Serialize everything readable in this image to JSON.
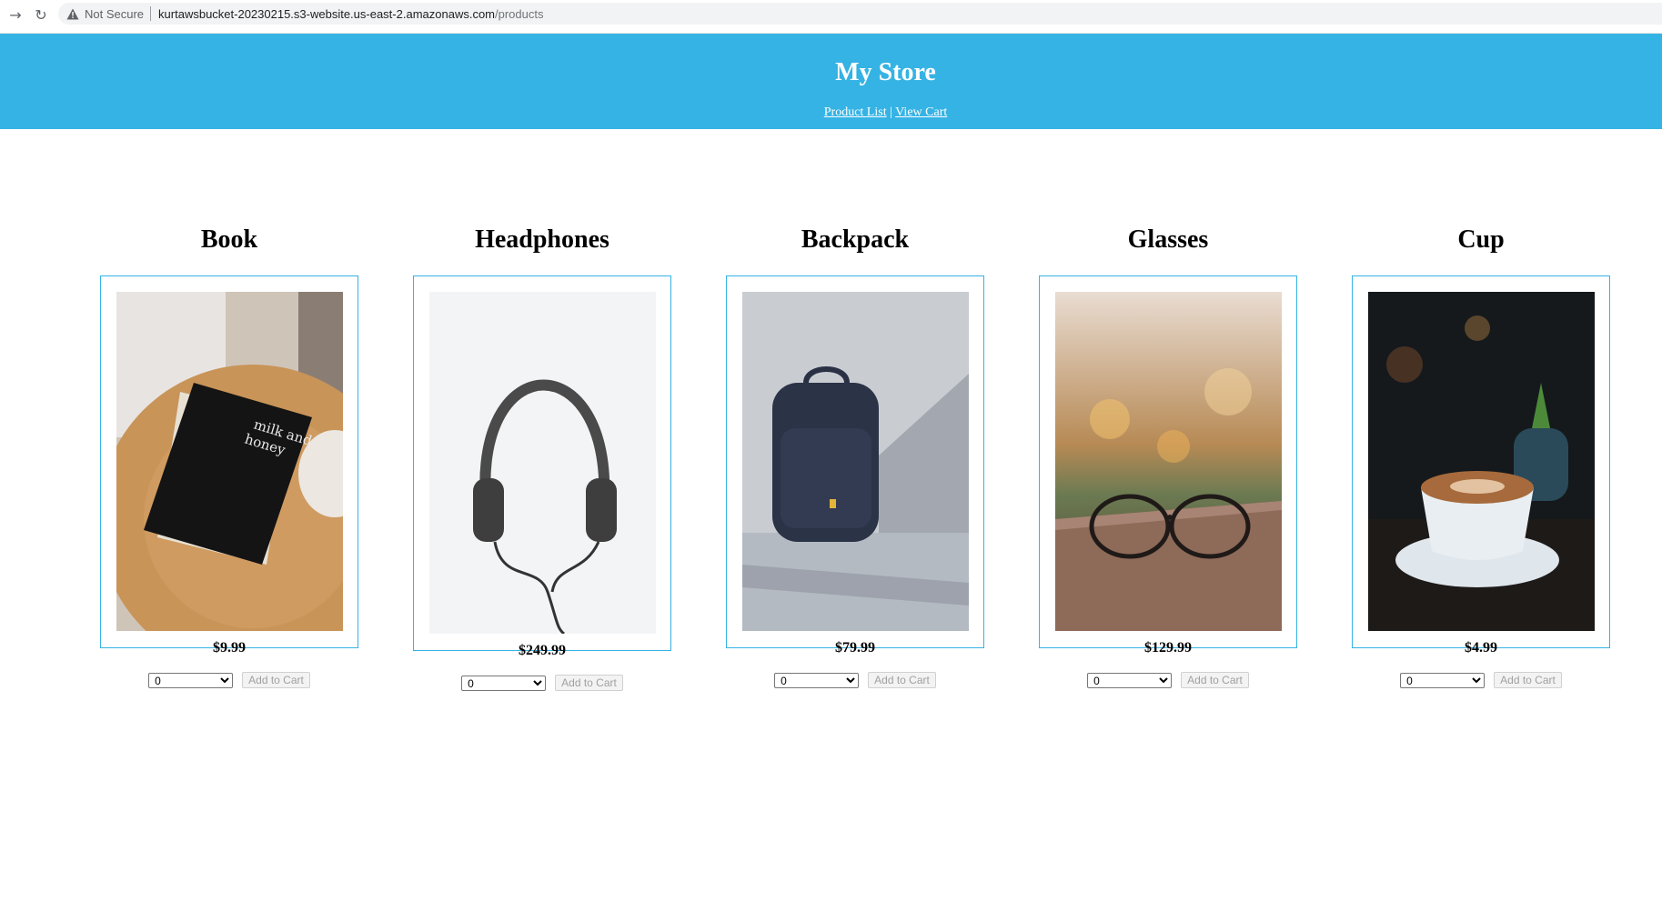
{
  "browser": {
    "security_label": "Not Secure",
    "url_host": "kurtawsbucket-20230215.s3-website.us-east-2.amazonaws.com",
    "url_path": "/products"
  },
  "store": {
    "title": "My Store",
    "nav": {
      "product_list": "Product List",
      "separator": "|",
      "view_cart": "View Cart"
    },
    "accent_color": "#35b3e4"
  },
  "products": [
    {
      "name": "Book",
      "price": "$9.99",
      "quantity": "0",
      "add_label": "Add to Cart",
      "image": "book-photo"
    },
    {
      "name": "Headphones",
      "price": "$249.99",
      "quantity": "0",
      "add_label": "Add to Cart",
      "image": "headphones-photo"
    },
    {
      "name": "Backpack",
      "price": "$79.99",
      "quantity": "0",
      "add_label": "Add to Cart",
      "image": "backpack-photo"
    },
    {
      "name": "Glasses",
      "price": "$129.99",
      "quantity": "0",
      "add_label": "Add to Cart",
      "image": "glasses-photo"
    },
    {
      "name": "Cup",
      "price": "$4.99",
      "quantity": "0",
      "add_label": "Add to Cart",
      "image": "cup-photo"
    }
  ]
}
